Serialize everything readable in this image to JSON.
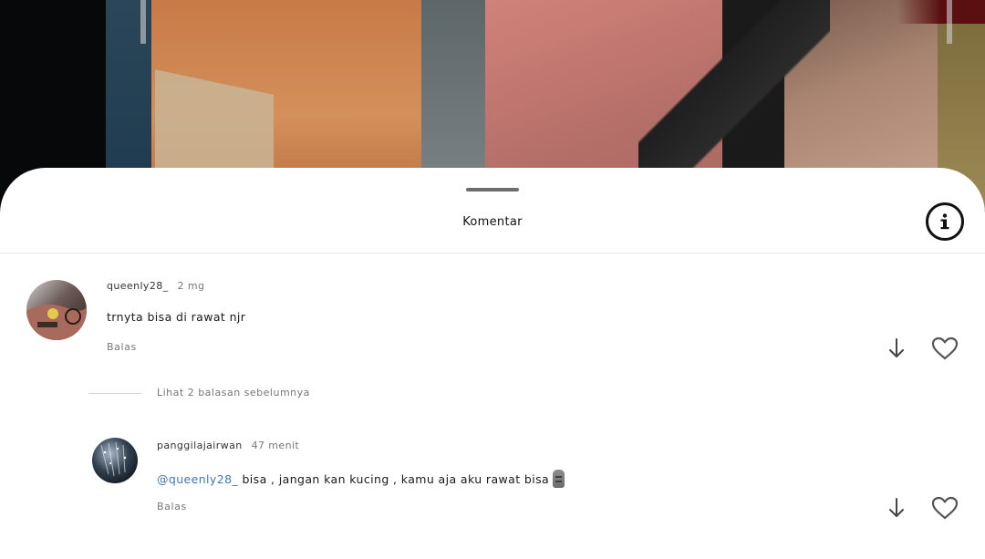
{
  "sheet": {
    "title": "Komentar",
    "info_icon": "info-circle-icon"
  },
  "comments": [
    {
      "username": "queenly28_",
      "time": "2 mg",
      "text": "trnyta bisa di rawat njr",
      "reply_label": "Balas",
      "icons": [
        "arrow-down-icon",
        "heart-outline-icon"
      ]
    }
  ],
  "more_replies": "Lihat 2 balasan sebelumnya",
  "replies": [
    {
      "username": "panggilajairwan",
      "time": "47 menit",
      "mention": "@queenly28_",
      "text": " bisa , jangan kan kucing , kamu aja aku rawat bisa",
      "emoji": "moai-emoji",
      "reply_label": "Balas",
      "icons": [
        "arrow-down-icon",
        "heart-outline-icon"
      ]
    }
  ]
}
